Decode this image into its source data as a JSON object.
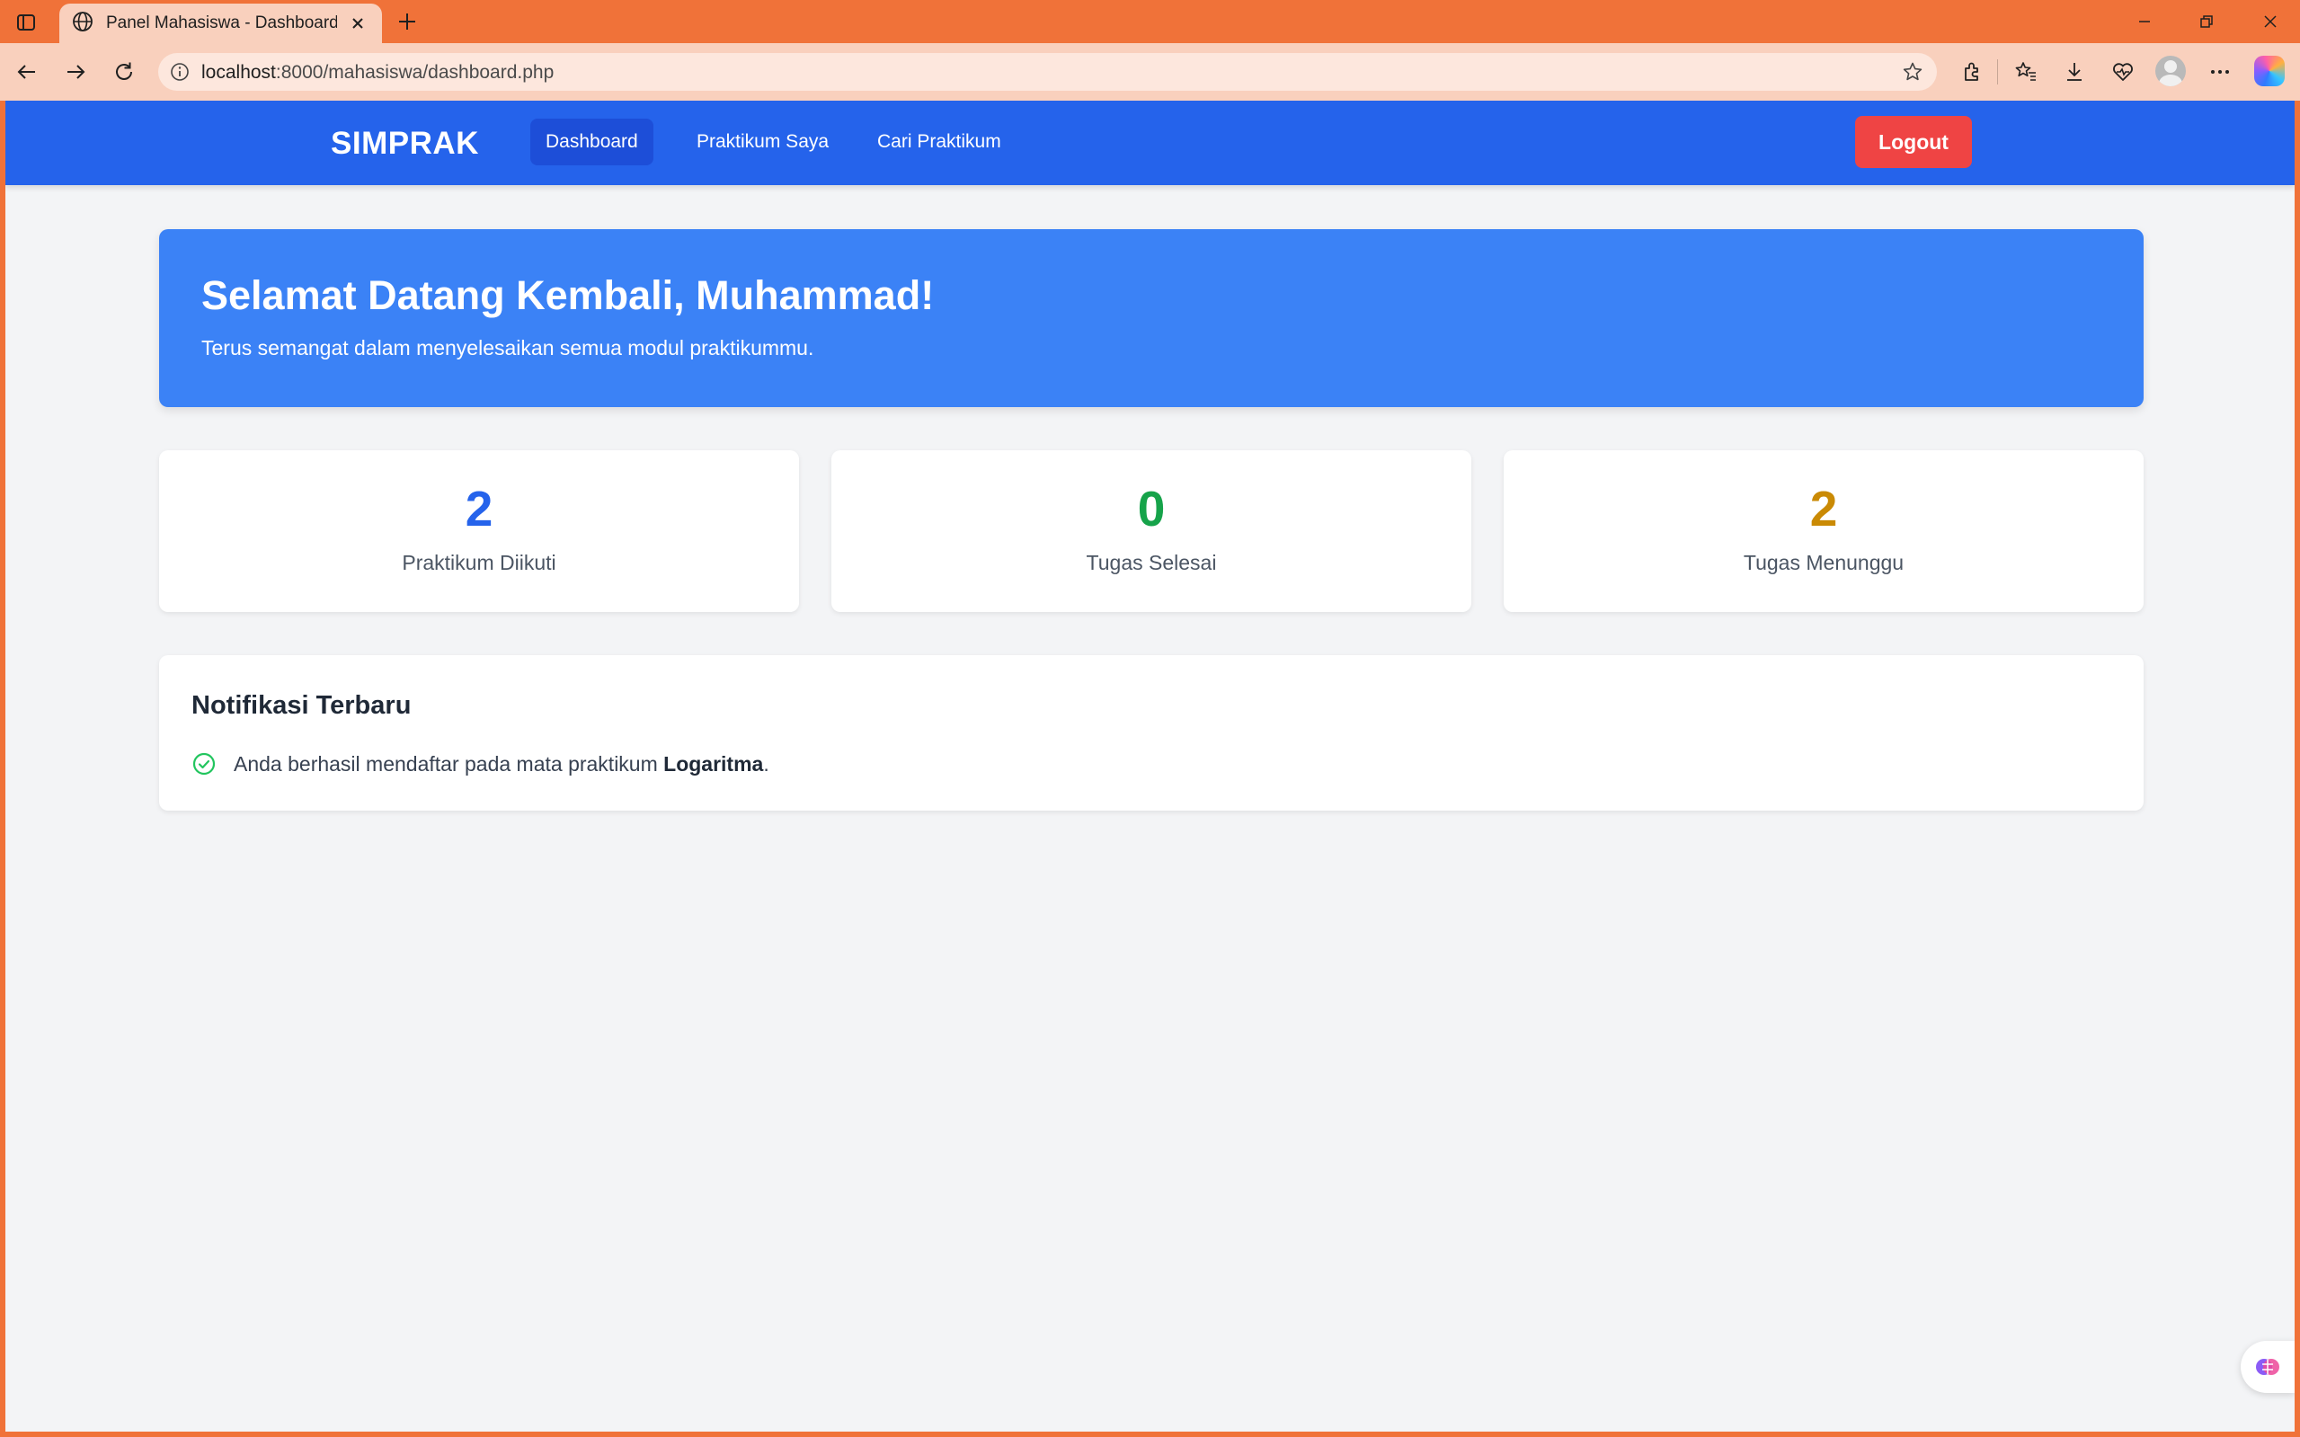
{
  "browser": {
    "tab_title": "Panel Mahasiswa - Dashboard Mahasiswa",
    "url_host": "localhost",
    "url_path": ":8000/mahasiswa/dashboard.php"
  },
  "nav": {
    "brand": "SIMPRAK",
    "links": [
      "Dashboard",
      "Praktikum Saya",
      "Cari Praktikum"
    ],
    "active": "Dashboard",
    "logout": "Logout"
  },
  "hero": {
    "title": "Selamat Datang Kembali, Muhammad!",
    "subtitle": "Terus semangat dalam menyelesaikan semua modul praktikummu."
  },
  "stats": [
    {
      "value": "2",
      "label": "Praktikum Diikuti",
      "color": "#2563eb"
    },
    {
      "value": "0",
      "label": "Tugas Selesai",
      "color": "#16a34a"
    },
    {
      "value": "2",
      "label": "Tugas Menunggu",
      "color": "#ca8a04"
    }
  ],
  "notifications": {
    "title": "Notifikasi Terbaru",
    "items": [
      {
        "icon": "check-circle-icon",
        "prefix": "Anda berhasil mendaftar pada mata praktikum ",
        "highlight": "Logaritma",
        "suffix": "."
      }
    ]
  },
  "colors": {
    "brand_blue": "#2563eb",
    "hero_blue": "#3b82f6",
    "logout_red": "#ef4444",
    "browser_accent": "#f07239"
  }
}
